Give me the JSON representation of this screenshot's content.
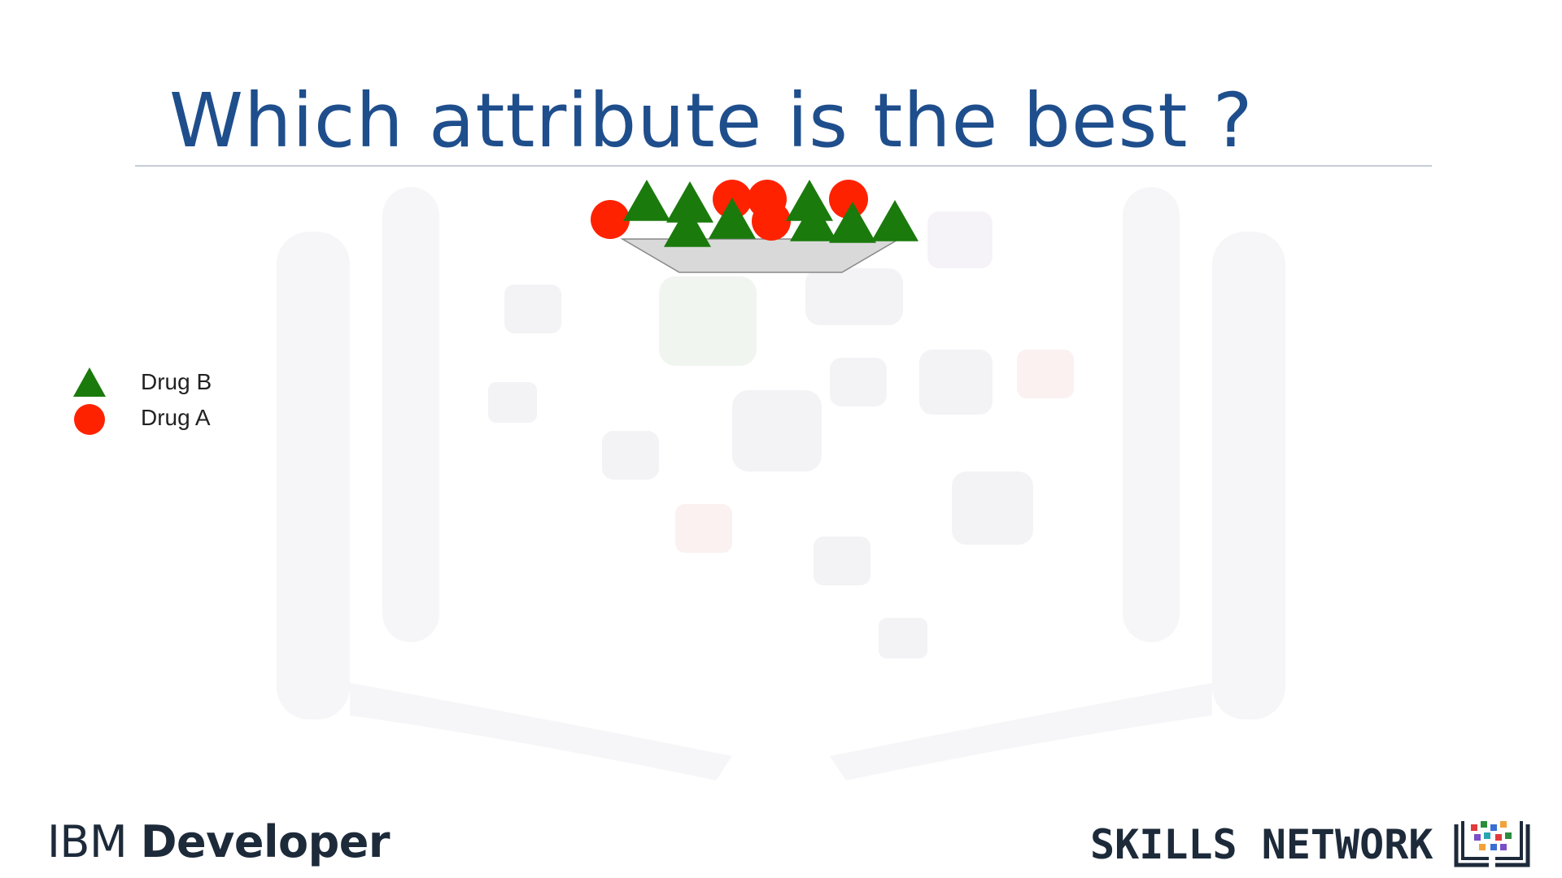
{
  "slide": {
    "title": "Which attribute is the best ?"
  },
  "legend": [
    {
      "label": "Drug B",
      "shape": "triangle",
      "color": "#1a7a0c"
    },
    {
      "label": "Drug A",
      "shape": "circle",
      "color": "#ff2200"
    }
  ],
  "node": {
    "shape": "tray",
    "fill": "#d9d9d9",
    "items": [
      {
        "shape": "circle",
        "drug": "Drug A"
      },
      {
        "shape": "triangle",
        "drug": "Drug B"
      },
      {
        "shape": "triangle",
        "drug": "Drug B"
      },
      {
        "shape": "circle",
        "drug": "Drug A"
      },
      {
        "shape": "triangle",
        "drug": "Drug B"
      },
      {
        "shape": "circle",
        "drug": "Drug A"
      },
      {
        "shape": "circle",
        "drug": "Drug A"
      },
      {
        "shape": "triangle",
        "drug": "Drug B"
      },
      {
        "shape": "triangle",
        "drug": "Drug B"
      },
      {
        "shape": "circle",
        "drug": "Drug A"
      },
      {
        "shape": "triangle",
        "drug": "Drug B"
      },
      {
        "shape": "triangle",
        "drug": "Drug B"
      },
      {
        "shape": "triangle",
        "drug": "Drug B"
      }
    ]
  },
  "branding": {
    "ibm_part": "IBM",
    "developer_part": "Developer",
    "skills_network": "SKILLS NETWORK",
    "skills_icon": "book-network-icon"
  },
  "colors": {
    "title": "#1f4e8c",
    "triangle": "#1a7a0c",
    "circle": "#ff2200"
  }
}
